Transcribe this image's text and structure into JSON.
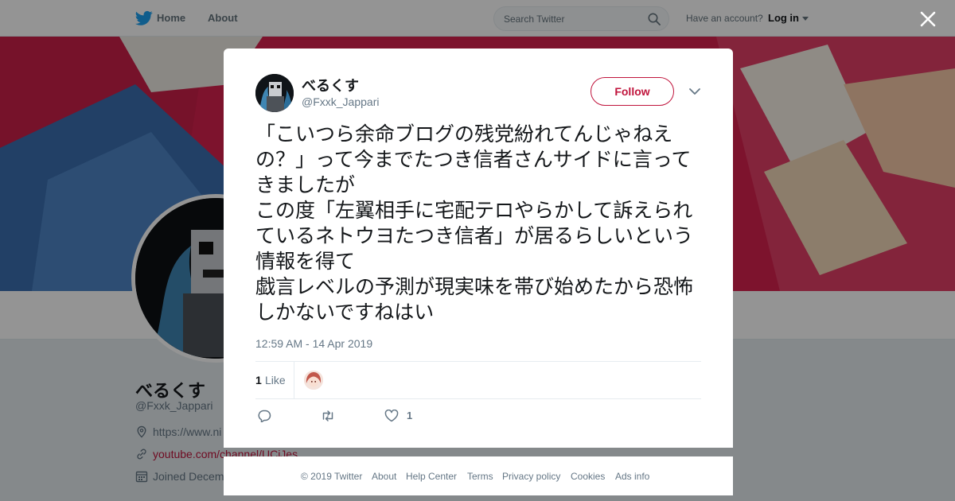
{
  "nav": {
    "home_label": "Home",
    "about_label": "About",
    "search_placeholder": "Search Twitter",
    "account_prompt": "Have an account?",
    "login_label": "Log in"
  },
  "colors": {
    "brand_blue": "#1da1f2",
    "link_accent": "#c0143c",
    "muted_text": "#657786",
    "banner": "#d8224f"
  },
  "profile": {
    "name": "べるくす",
    "handle": "@Fxxk_Jappari",
    "website": "https://www.ni",
    "youtube": "youtube.com/channel/UCjJes",
    "joined": "Joined Decem"
  },
  "tweet": {
    "author_name": "べるくす",
    "author_handle": "@Fxxk_Jappari",
    "follow_label": "Follow",
    "text": "「こいつら余命ブログの残党紛れてんじゃねえの？」って今までたつき信者さんサイドに言ってきましたが\nこの度「左翼相手に宅配テロやらかして訴えられているネトウヨたつき信者」が居るらしいという情報を得て\n戯言レベルの予測が現実味を帯び始めたから恐怖しかないですねはい",
    "timestamp": "12:59 AM - 14 Apr 2019",
    "likes_count": "1",
    "likes_label": "Like",
    "action_like_count": "1"
  },
  "icons": {
    "close": "close-icon",
    "logo": "twitter-bird-icon",
    "search": "search-icon",
    "more": "chevron-down-icon",
    "reply": "reply-icon",
    "retweet": "retweet-icon",
    "like": "heart-icon",
    "location": "location-pin-icon",
    "link": "link-icon",
    "calendar": "calendar-icon"
  },
  "footer": {
    "copyright": "© 2019 Twitter",
    "about": "About",
    "help": "Help Center",
    "terms": "Terms",
    "privacy": "Privacy policy",
    "cookies": "Cookies",
    "ads": "Ads info"
  }
}
